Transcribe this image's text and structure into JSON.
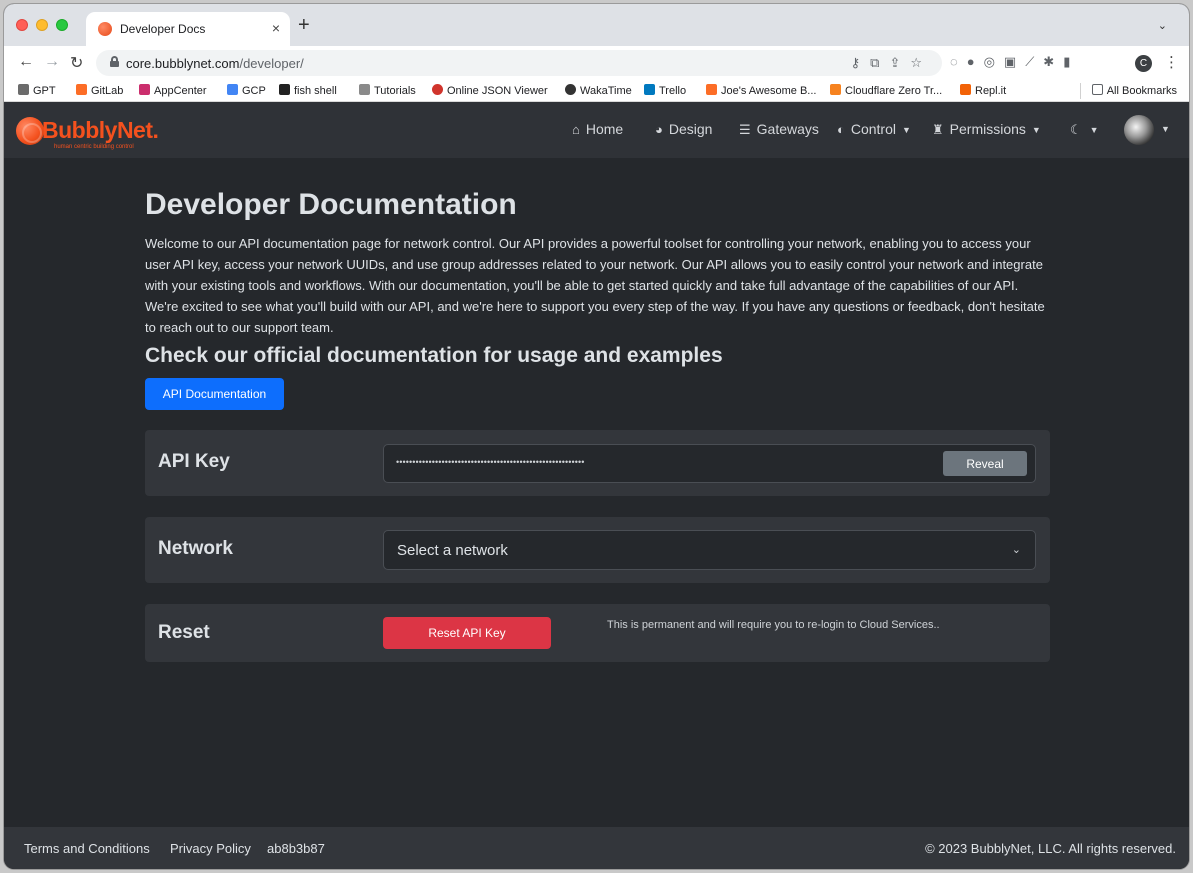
{
  "browser": {
    "tab_title": "Developer Docs",
    "tab_close": "×",
    "new_tab": "+",
    "tab_menu": "⌄",
    "url_host": "core.bubblynet.com",
    "url_path": "/developer/",
    "profile_initial": "C",
    "bookmarks": [
      {
        "label": "GPT",
        "color": "#6b6b6b"
      },
      {
        "label": "GitLab",
        "color": "#fc6d26"
      },
      {
        "label": "AppCenter",
        "color": "#cb2e6d"
      },
      {
        "label": "GCP",
        "color": "#4285f4"
      },
      {
        "label": "fish shell",
        "color": "#222222"
      },
      {
        "label": "Tutorials",
        "color": "#8a8a8a"
      },
      {
        "label": "Online JSON Viewer",
        "color": "#d0342c"
      },
      {
        "label": "WakaTime",
        "color": "#333333"
      },
      {
        "label": "Trello",
        "color": "#0079bf"
      },
      {
        "label": "Joe's Awesome B...",
        "color": "#fc6d26"
      },
      {
        "label": "Cloudflare Zero Tr...",
        "color": "#f6821f"
      },
      {
        "label": "Repl.it",
        "color": "#f26207"
      }
    ],
    "all_bookmarks": "All Bookmarks"
  },
  "brand": {
    "name": "BubblyNet.",
    "tagline": "human centric building control"
  },
  "nav": {
    "home": "Home",
    "design": "Design",
    "gateways": "Gateways",
    "control": "Control",
    "permissions": "Permissions"
  },
  "page": {
    "title": "Developer Documentation",
    "intro": "Welcome to our API documentation page for network control. Our API provides a powerful toolset for controlling your network, enabling you to access your user API key, access your network UUIDs, and use group addresses related to your network. Our API allows you to easily control your network and integrate with your existing tools and workflows. With our documentation, you'll be able to get started quickly and take full advantage of the capabilities of our API. We're excited to see what you'll build with our API, and we're here to support you every step of the way. If you have any questions or feedback, don't hesitate to reach out to our support team.",
    "subtitle": "Check our official documentation for usage and examples",
    "api_doc_button": "API Documentation"
  },
  "api_key": {
    "label": "API Key",
    "masked_value": "••••••••••••••••••••••••••••••••••••••••••••••••••••••••••",
    "reveal_button": "Reveal"
  },
  "network": {
    "label": "Network",
    "placeholder": "Select a network"
  },
  "reset": {
    "label": "Reset",
    "button": "Reset API Key",
    "note": "This is permanent and will require you to re-login to Cloud Services.."
  },
  "footer": {
    "terms": "Terms and Conditions",
    "privacy": "Privacy Policy",
    "build": "ab8b3b87",
    "copyright": "© 2023 BubblyNet, LLC. All rights reserved."
  }
}
